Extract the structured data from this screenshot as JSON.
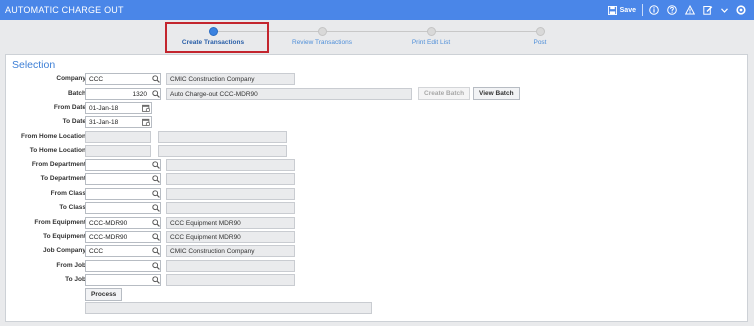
{
  "header": {
    "title": "AUTOMATIC CHARGE OUT",
    "save_label": "Save",
    "icons": [
      "save-icon",
      "info-icon",
      "help-icon",
      "warning-icon",
      "edit-icon",
      "dropdown-icon",
      "settings-icon"
    ]
  },
  "steps": [
    {
      "label": "Create Transactions",
      "active": true
    },
    {
      "label": "Review Transactions",
      "active": false
    },
    {
      "label": "Print Edit List",
      "active": false
    },
    {
      "label": "Post",
      "active": false
    }
  ],
  "form": {
    "section_title": "Selection",
    "company": {
      "label": "Company",
      "value": "CCC",
      "desc": "CMIC Construction Company"
    },
    "batch": {
      "label": "Batch",
      "value": "1320",
      "desc": "Auto Charge-out CCC-MDR90",
      "create_batch_label": "Create Batch",
      "view_batch_label": "View Batch"
    },
    "from_date": {
      "label": "From Date",
      "value": "01-Jan-18"
    },
    "to_date": {
      "label": "To Date",
      "value": "31-Jan-18"
    },
    "from_home_location": {
      "label": "From Home Location",
      "value": "",
      "desc": ""
    },
    "to_home_location": {
      "label": "To Home Location",
      "value": "",
      "desc": ""
    },
    "from_department": {
      "label": "From Department",
      "value": "",
      "desc": ""
    },
    "to_department": {
      "label": "To Department",
      "value": "",
      "desc": ""
    },
    "from_class": {
      "label": "From Class",
      "value": "",
      "desc": ""
    },
    "to_class": {
      "label": "To Class",
      "value": "",
      "desc": ""
    },
    "from_equipment": {
      "label": "From Equipment",
      "value": "CCC-MDR90",
      "desc": "CCC Equipment MDR90"
    },
    "to_equipment": {
      "label": "To Equipment",
      "value": "CCC-MDR90",
      "desc": "CCC Equipment MDR90"
    },
    "job_company": {
      "label": "Job Company",
      "value": "CCC",
      "desc": "CMIC Construction Company"
    },
    "from_job": {
      "label": "From Job",
      "value": "",
      "desc": ""
    },
    "to_job": {
      "label": "To Job",
      "value": "",
      "desc": ""
    },
    "process_label": "Process",
    "status_text": ""
  },
  "colors": {
    "header_bg": "#4a86e8",
    "accent": "#3d7fd6",
    "highlight": "#c3252e"
  }
}
